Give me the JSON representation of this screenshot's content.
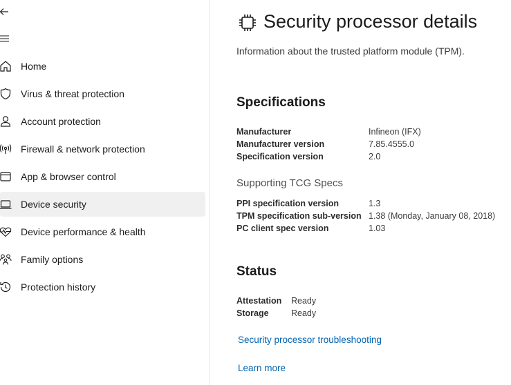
{
  "sidebar": {
    "items": [
      {
        "label": "Home",
        "icon": "home-icon"
      },
      {
        "label": "Virus & threat protection",
        "icon": "shield-icon"
      },
      {
        "label": "Account protection",
        "icon": "person-icon"
      },
      {
        "label": "Firewall & network protection",
        "icon": "antenna-icon"
      },
      {
        "label": "App & browser control",
        "icon": "app-window-icon"
      },
      {
        "label": "Device security",
        "icon": "laptop-icon",
        "selected": true
      },
      {
        "label": "Device performance & health",
        "icon": "heart-pulse-icon"
      },
      {
        "label": "Family options",
        "icon": "family-icon"
      },
      {
        "label": "Protection history",
        "icon": "history-icon"
      }
    ]
  },
  "main": {
    "title": "Security processor details",
    "subtitle": "Information about the trusted platform module (TPM).",
    "specifications": {
      "heading": "Specifications",
      "rows": [
        {
          "key": "Manufacturer",
          "value": "Infineon (IFX)"
        },
        {
          "key": "Manufacturer version",
          "value": "7.85.4555.0"
        },
        {
          "key": "Specification version",
          "value": "2.0"
        }
      ]
    },
    "tcg": {
      "heading": "Supporting TCG Specs",
      "rows": [
        {
          "key": "PPI specification version",
          "value": "1.3"
        },
        {
          "key": "TPM specification sub-version",
          "value": "1.38 (Monday, January 08, 2018)"
        },
        {
          "key": "PC client spec version",
          "value": "1.03"
        }
      ]
    },
    "status": {
      "heading": "Status",
      "rows": [
        {
          "key": "Attestation",
          "value": "Ready"
        },
        {
          "key": "Storage",
          "value": "Ready"
        }
      ]
    },
    "links": {
      "troubleshooting": "Security processor troubleshooting",
      "learn_more": "Learn more"
    }
  },
  "colors": {
    "link": "#0063b1",
    "selected_bg": "#f0f0f0"
  }
}
